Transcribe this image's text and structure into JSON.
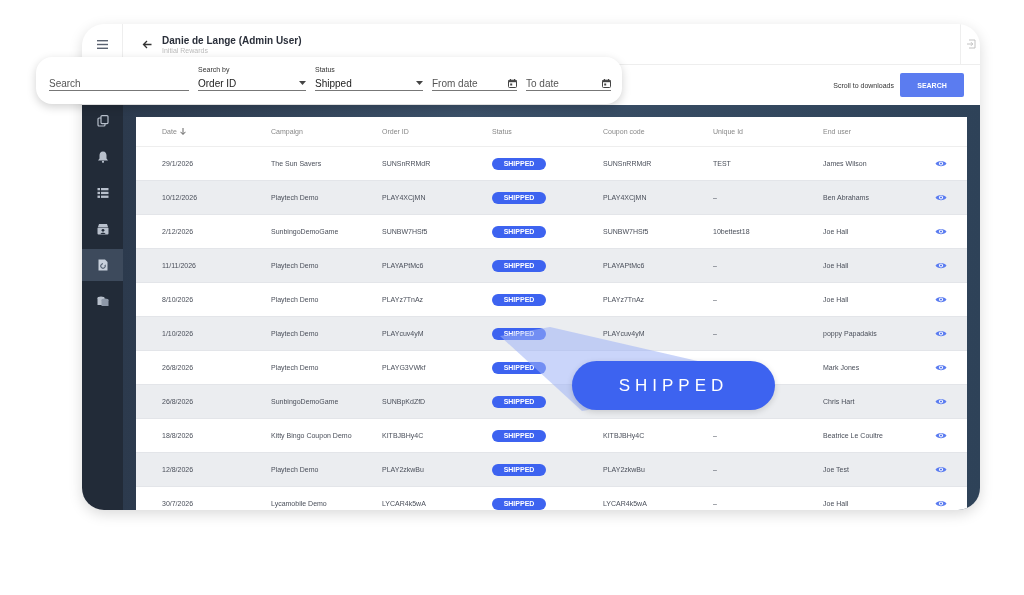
{
  "header": {
    "title": "Danie de Lange (Admin User)",
    "subtitle": "Initial Rewards"
  },
  "filters": [
    {
      "kind": "text",
      "placeholder": "Search"
    },
    {
      "kind": "select",
      "label": "Search by",
      "value": "Order ID"
    },
    {
      "kind": "select",
      "label": "Status",
      "value": "Shipped"
    },
    {
      "kind": "date",
      "placeholder": "From date"
    },
    {
      "kind": "date",
      "placeholder": "To date"
    }
  ],
  "toolbar": {
    "link": "Scroll to downloads",
    "button": "SEARCH"
  },
  "sidebar": {
    "items": [
      {
        "selected": false
      },
      {
        "selected": false
      },
      {
        "selected": false
      },
      {
        "selected": false
      },
      {
        "selected": true
      },
      {
        "selected": false
      }
    ]
  },
  "table": {
    "columns": [
      {
        "label": "Date",
        "sorted": true
      },
      {
        "label": "Campaign"
      },
      {
        "label": "Order ID"
      },
      {
        "label": "Status"
      },
      {
        "label": "Coupon code"
      },
      {
        "label": "Unique Id"
      },
      {
        "label": "End user"
      }
    ],
    "rows": [
      {
        "date": "29/1/2026",
        "campaign": "The Sun Savers",
        "order_id": "SUNSnRRMdR",
        "status": "SHIPPED",
        "coupon_code": "SUNSnRRMdR",
        "unique_id": "TEST",
        "end_user": "James Wilson"
      },
      {
        "date": "10/12/2026",
        "campaign": "Playtech Demo",
        "order_id": "PLAY4XCjMN",
        "status": "SHIPPED",
        "coupon_code": "PLAY4XCjMN",
        "unique_id": "–",
        "end_user": "Ben Abrahams"
      },
      {
        "date": "2/12/2026",
        "campaign": "SunbingoDemoGame",
        "order_id": "SUNBW7HSf5",
        "status": "SHIPPED",
        "coupon_code": "SUNBW7HSf5",
        "unique_id": "10bettest18",
        "end_user": "Joe Hall"
      },
      {
        "date": "11/11/2026",
        "campaign": "Playtech Demo",
        "order_id": "PLAYAPtMc6",
        "status": "SHIPPED",
        "coupon_code": "PLAYAPtMc6",
        "unique_id": "–",
        "end_user": "Joe Hall"
      },
      {
        "date": "8/10/2026",
        "campaign": "Playtech Demo",
        "order_id": "PLAYz7TnAz",
        "status": "SHIPPED",
        "coupon_code": "PLAYz7TnAz",
        "unique_id": "–",
        "end_user": "Joe Hall"
      },
      {
        "date": "1/10/2026",
        "campaign": "Playtech Demo",
        "order_id": "PLAYcuv4yM",
        "status": "SHIPPED",
        "coupon_code": "PLAYcuv4yM",
        "unique_id": "–",
        "end_user": "poppy Papadakis"
      },
      {
        "date": "26/8/2026",
        "campaign": "Playtech Demo",
        "order_id": "PLAYG3VWkf",
        "status": "SHIPPED",
        "end_user": "Mark Jones"
      },
      {
        "date": "26/8/2026",
        "campaign": "SunbingoDemoGame",
        "order_id": "SUNBpKdZfD",
        "status": "SHIPPED",
        "end_user": "Chris Hart"
      },
      {
        "date": "18/8/2026",
        "campaign": "Kitty Bingo Coupon Demo",
        "order_id": "KITBJBHy4C",
        "status": "SHIPPED",
        "coupon_code": "KITBJBHy4C",
        "unique_id": "–",
        "end_user": "Beatrice Le Coultre"
      },
      {
        "date": "12/8/2026",
        "campaign": "Playtech Demo",
        "order_id": "PLAY2zkwBu",
        "status": "SHIPPED",
        "coupon_code": "PLAY2zkwBu",
        "unique_id": "–",
        "end_user": "Joe Test"
      },
      {
        "date": "30/7/2026",
        "campaign": "Lycamobile Demo",
        "order_id": "LYCAR4k5wA",
        "status": "SHIPPED",
        "coupon_code": "LYCAR4k5wA",
        "unique_id": "–",
        "end_user": "Joe Hall"
      }
    ]
  },
  "callout": {
    "text": "SHIPPED"
  }
}
